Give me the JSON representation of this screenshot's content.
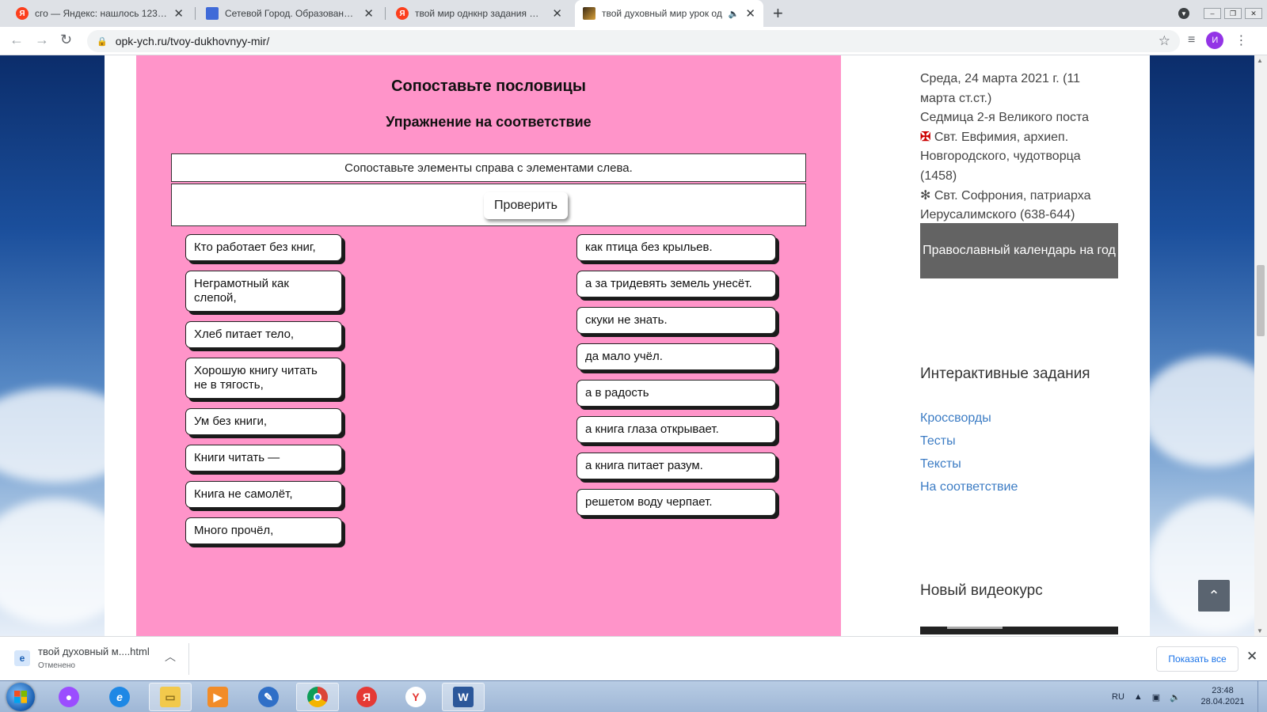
{
  "browser": {
    "tabs": [
      {
        "title": "сго — Яндекс: нашлось 123 млн",
        "close": "✕"
      },
      {
        "title": "Сетевой Город. Образование. К",
        "close": "✕"
      },
      {
        "title": "твой мир однкнр задания — Ян",
        "close": "✕"
      },
      {
        "title": "твой духовный мир урок од",
        "close": "✕",
        "audio": "🔈"
      }
    ],
    "new_tab": "+",
    "url": "opk-ych.ru/tvoy-dukhovnyy-mir/",
    "profile_initial": "И"
  },
  "exercise": {
    "title": "Сопоставьте пословицы",
    "subtitle": "Упражнение на соответствие",
    "instruction": "Сопоставьте элементы справа с элементами слева.",
    "check_label": "Проверить",
    "left_items": [
      "Кто работает без книг,",
      "Неграмотный как слепой,",
      "Хлеб питает тело,",
      "Хорошую книгу читать не в тягость,",
      "Ум без книги,",
      "Книги читать —",
      "Книга не самолёт,",
      "Много прочёл,"
    ],
    "right_items": [
      "как птица без крыльев.",
      "а за тридевять земель унесёт.",
      "скуки не знать.",
      "да мало учёл.",
      "а в радость",
      "а книга глаза открывает.",
      "а книга питает разум.",
      "решетом воду черпает."
    ]
  },
  "sidebar": {
    "calendar": {
      "date_line": "Среда, 24 марта 2021 г. (11 марта ст.ст.)",
      "week_line": "Седмица 2-я Великого поста",
      "saint1": "Свт. Евфимия, архиеп. Новгородского, чудотворца (1458)",
      "saint2": "Свт. Софрония, патриарха Иерусалимского (638-644)",
      "button": "Православный календарь на год"
    },
    "interactive": {
      "title": "Интерактивные задания",
      "links": [
        "Кроссворды",
        "Тесты",
        "Тексты",
        "На соответствие"
      ]
    },
    "video": {
      "title": "Новый видеокурс"
    }
  },
  "downloads": {
    "file_name": "твой духовный м....html",
    "status": "Отменено",
    "show_all": "Показать все",
    "close": "✕"
  },
  "taskbar": {
    "lang": "RU",
    "time": "23:48",
    "date": "28.04.2021"
  },
  "icons": {
    "saint1": "red-cross-icon",
    "saint2": "star-cross-icon"
  }
}
